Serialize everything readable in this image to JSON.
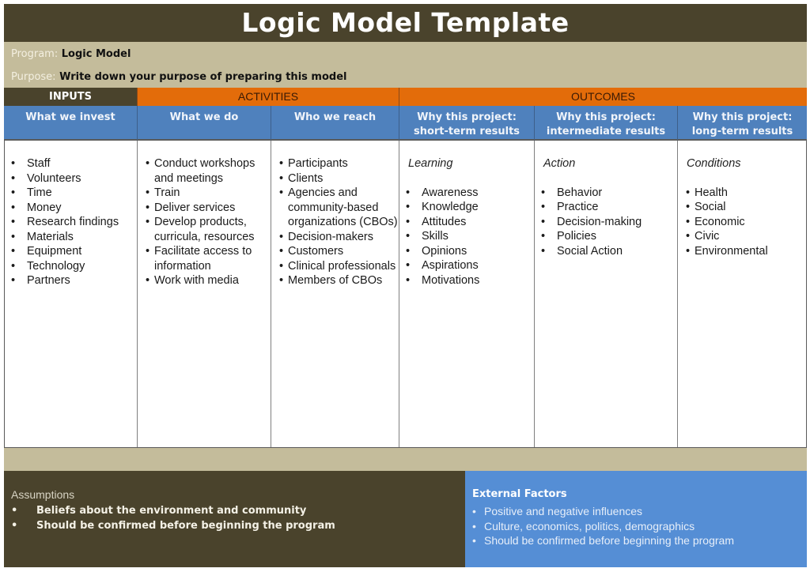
{
  "title": "Logic Model Template",
  "program": {
    "label": "Program:",
    "value": "Logic Model"
  },
  "purpose": {
    "label": "Purpose:",
    "value": "Write down your purpose of preparing this model"
  },
  "groups": {
    "inputs": "INPUTS",
    "activities": "ACTIVITIES",
    "outcomes": "OUTCOMES"
  },
  "columns": [
    {
      "header": "What we invest",
      "subhead": "",
      "items": [
        "Staff",
        "Volunteers",
        "Time",
        "Money",
        "Research findings",
        "Materials",
        "Equipment",
        "Technology",
        "Partners"
      ]
    },
    {
      "header": "What we do",
      "subhead": "",
      "items": [
        "Conduct workshops and meetings",
        "Train",
        "Deliver services",
        "Develop products, curricula, resources",
        "Facilitate access to information",
        "Work with media"
      ]
    },
    {
      "header": "Who we reach",
      "subhead": "",
      "items": [
        "Participants",
        "Clients",
        "Agencies and community-based organizations (CBOs)",
        "Decision-makers",
        "Customers",
        "Clinical professionals",
        "Members of CBOs"
      ]
    },
    {
      "header_line1": "Why this project:",
      "header_line2": "short-term results",
      "subhead": "Learning",
      "items": [
        "Awareness",
        "Knowledge",
        "Attitudes",
        "Skills",
        "Opinions",
        "Aspirations",
        "Motivations"
      ]
    },
    {
      "header_line1": "Why this project:",
      "header_line2": "intermediate results",
      "subhead": "Action",
      "items": [
        "Behavior",
        "Practice",
        "Decision-making",
        "Policies",
        "Social Action"
      ]
    },
    {
      "header_line1": "Why this project:",
      "header_line2": "long-term results",
      "subhead": "Conditions",
      "items": [
        "Health",
        "Social",
        "Economic",
        "Civic",
        "Environmental"
      ]
    }
  ],
  "assumptions": {
    "heading": "Assumptions",
    "items": [
      "Beliefs about the environment and community",
      "Should be confirmed before beginning the program"
    ]
  },
  "external_factors": {
    "heading": "External Factors",
    "items": [
      "Positive and negative influences",
      "Culture, economics, politics, demographics",
      "Should be confirmed before beginning the program"
    ]
  },
  "colors": {
    "dark_olive": "#4a432c",
    "tan": "#c4bc9b",
    "orange": "#e36c0a",
    "blue_header": "#4f81bd",
    "blue_external": "#558ed5"
  }
}
